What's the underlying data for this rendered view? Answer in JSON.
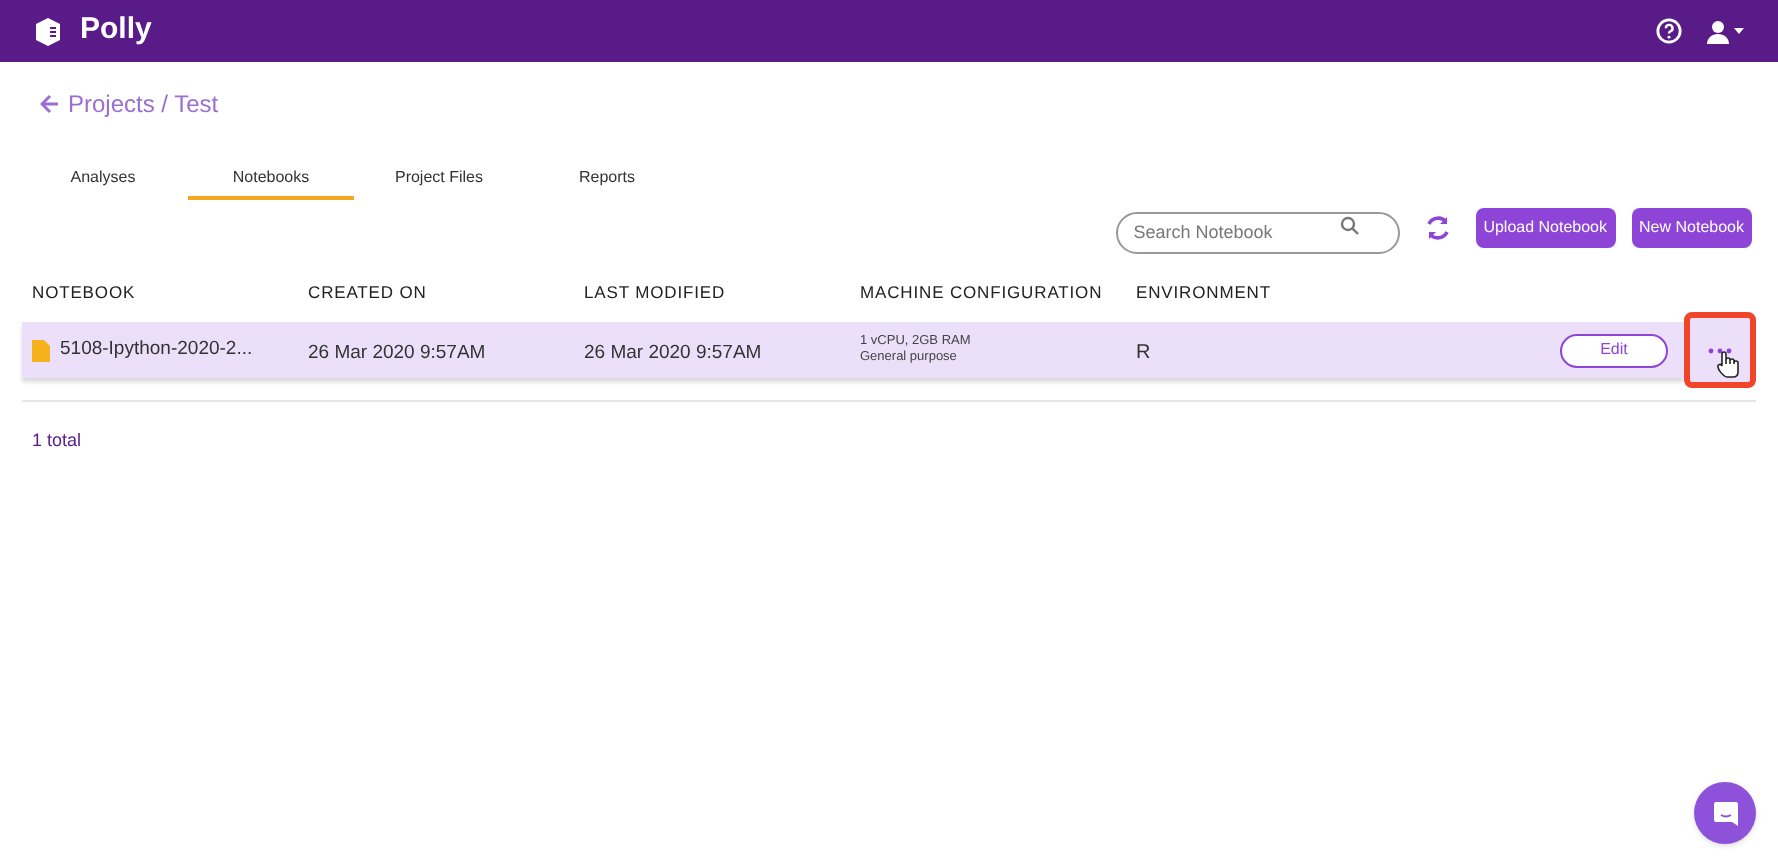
{
  "header": {
    "brand": "Polly"
  },
  "breadcrumb": "Projects / Test",
  "tabs": [
    {
      "label": "Analyses",
      "selected": false
    },
    {
      "label": "Notebooks",
      "selected": true
    },
    {
      "label": "Project Files",
      "selected": false
    },
    {
      "label": "Reports",
      "selected": false
    }
  ],
  "search": {
    "placeholder": "Search Notebook"
  },
  "buttons": [
    "Upload Notebook",
    "New Notebook"
  ],
  "table": {
    "columns": [
      "NOTEBOOK",
      "CREATED ON",
      "LAST MODIFIED",
      "MACHINE CONFIGURATION",
      "ENVIRONMENT"
    ],
    "rows": [
      {
        "name": "5108-Ipython-2020-2...",
        "created": "26 Mar 2020 9:57AM",
        "modified": "26 Mar 2020 9:57AM",
        "machine": "1 vCPU, 2GB RAM",
        "machine_type": "General purpose",
        "environment": "R",
        "action": "Edit",
        "selected": true
      }
    ]
  },
  "footer": "1 total"
}
